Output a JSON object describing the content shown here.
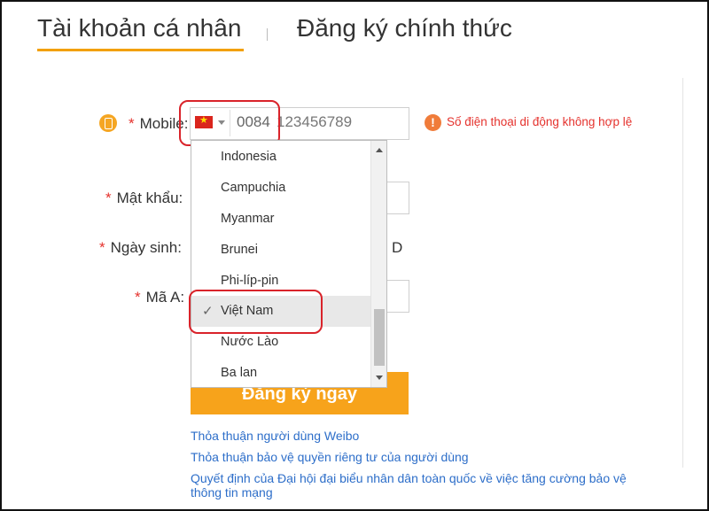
{
  "tabs": {
    "personal": "Tài khoản cá nhân",
    "official": "Đăng ký chính thức"
  },
  "form": {
    "required_mark": "*",
    "mobile_label": "Mobile:",
    "password_label": "Mật khẩu:",
    "birthday_label": "Ngày sinh:",
    "captcha_label": "Mã A:",
    "birthday_trailing": "D",
    "country_prefix": "0084",
    "phone_value": "123456789",
    "error_message": "Số điện thoại di động không hợp lệ",
    "submit_label": "Đăng ký ngay"
  },
  "dropdown": {
    "selected_check": "✓",
    "items": [
      "Indonesia",
      "Campuchia",
      "Myanmar",
      "Brunei",
      "Phi-líp-pin",
      "Việt Nam",
      "Nước Lào",
      "Ba lan"
    ],
    "selected": "Việt Nam",
    "scroll_position": 0.72
  },
  "links": {
    "user_agreement": "Thỏa thuận người dùng Weibo",
    "privacy": "Thỏa thuận bảo vệ quyền riêng tư của người dùng",
    "decision_line1": "Quyết định của Đại hội đại biểu nhân dân toàn quốc về việc tăng cường bảo vệ",
    "decision_line2": "thông tin mạng"
  },
  "colors": {
    "accent": "#f7a31b",
    "error": "#e5322d",
    "link": "#2d6ec9",
    "highlight": "#d9232a"
  },
  "icons": {
    "phone": "phone-icon",
    "flag": "vietnam-flag-icon",
    "error": "error-icon",
    "check": "check-icon"
  }
}
